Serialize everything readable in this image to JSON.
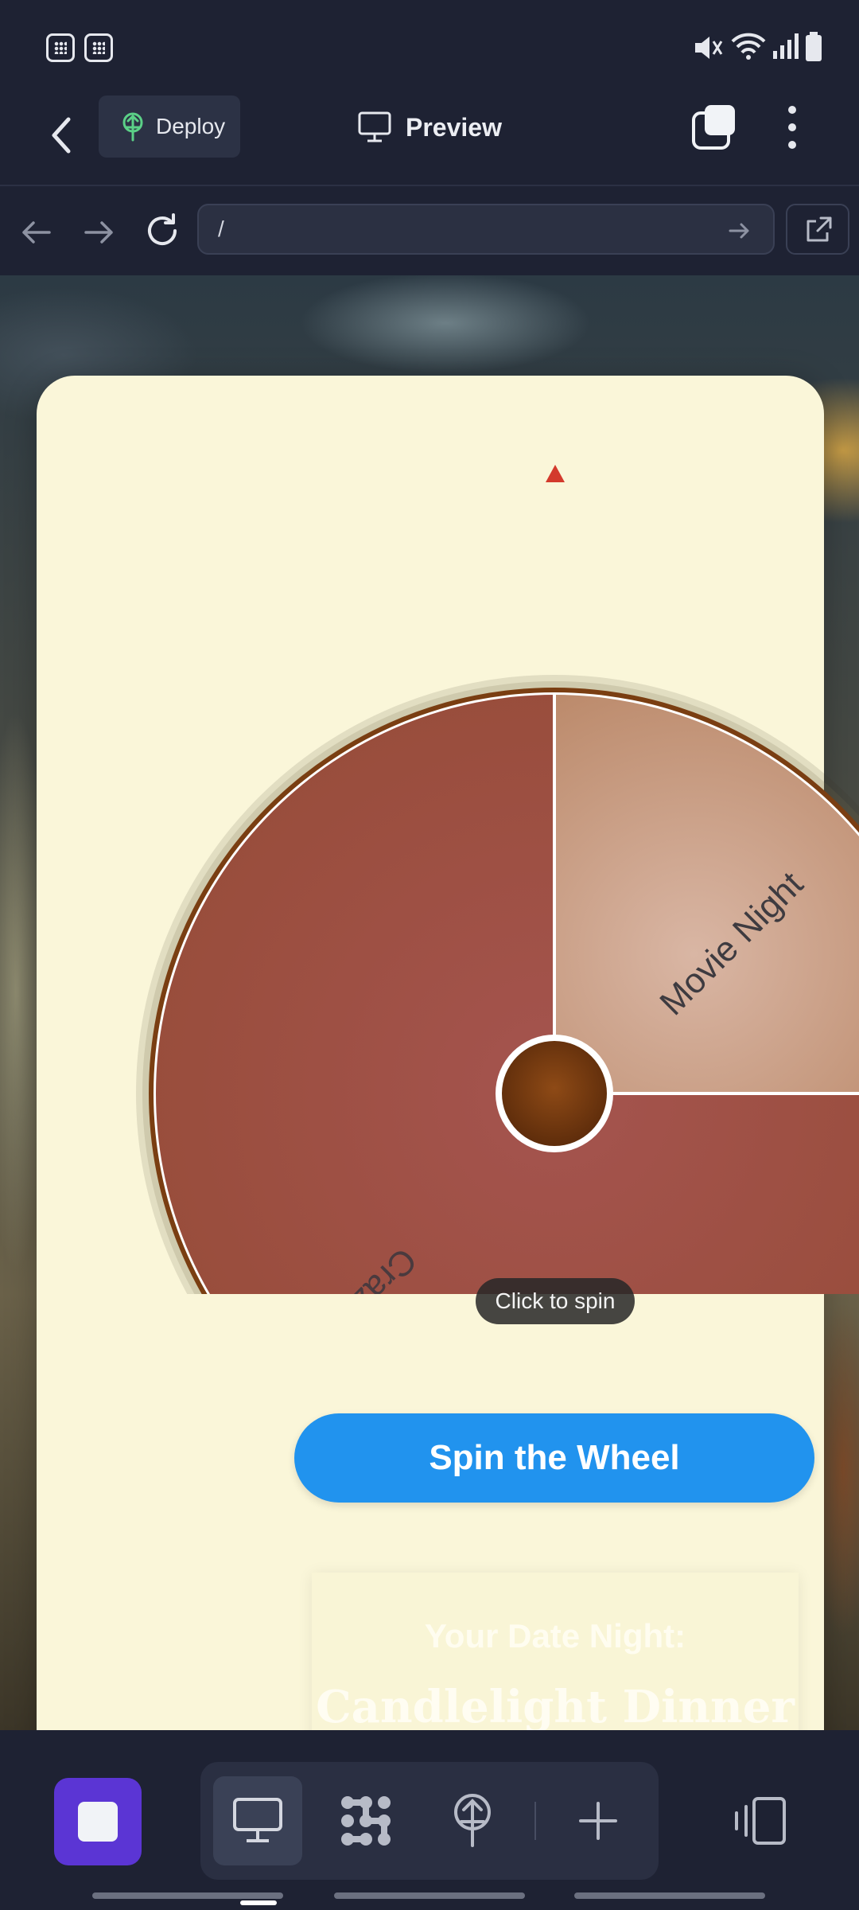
{
  "toolbar": {
    "deploy_label": "Deploy",
    "preview_label": "Preview"
  },
  "nav": {
    "url": "/"
  },
  "wheel": {
    "segments": [
      {
        "label": "Movie Night",
        "color": "#c28a6e"
      },
      {
        "label": "Crazy",
        "color": "#a2544a"
      }
    ],
    "tooltip": "Click to spin"
  },
  "actions": {
    "spin_label": "Spin the Wheel"
  },
  "result": {
    "label": "Your Date Night:",
    "value": "Candlelight Dinner"
  },
  "colors": {
    "accent": "#2193ee",
    "stop": "#5b35d4",
    "pointer": "#d33a2c",
    "rim": "#7a3e12"
  }
}
